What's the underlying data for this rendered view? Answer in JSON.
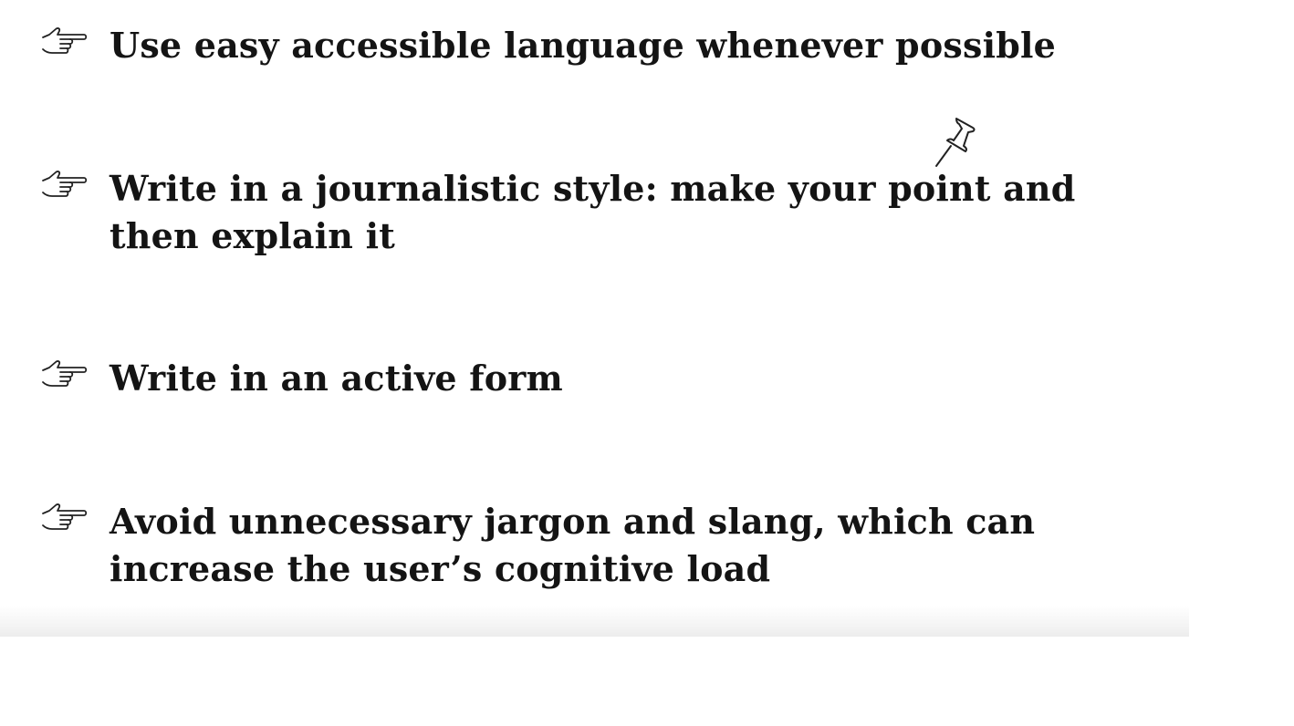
{
  "tips": [
    {
      "icon": "pointing-hand-icon",
      "text": "Use easy accessible language whenever possible"
    },
    {
      "icon": "pointing-hand-icon",
      "text": "Write in a journalistic style: make your point and then explain it"
    },
    {
      "icon": "pointing-hand-icon",
      "text": "Write in an active form"
    },
    {
      "icon": "pointing-hand-icon",
      "text": "Avoid unnecessary jargon and slang, which can increase the user’s cognitive load"
    }
  ],
  "pin": {
    "icon": "pushpin-icon"
  },
  "colors": {
    "text": "#141414",
    "background": "#ffffff",
    "icon_stroke": "#222222"
  }
}
